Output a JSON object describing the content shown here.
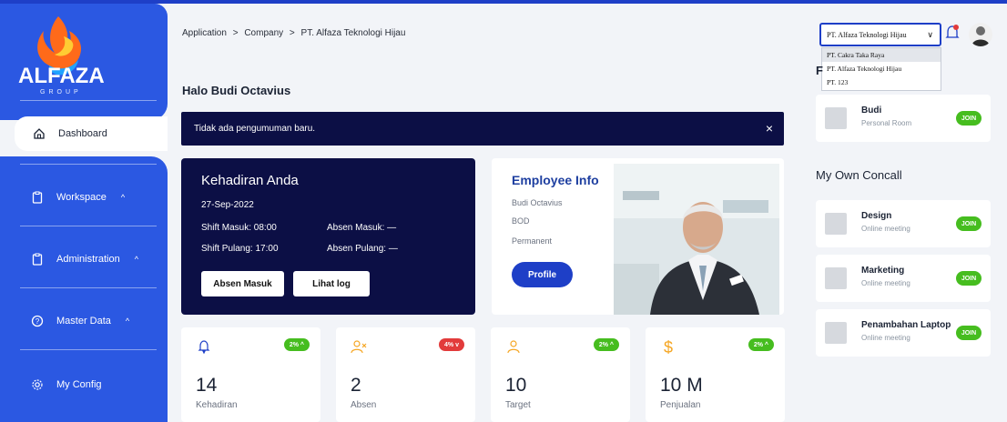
{
  "brand": {
    "name": "ALFAZA",
    "sub": "GROUP"
  },
  "sidebar": {
    "items": [
      {
        "label": "Dashboard"
      },
      {
        "label": "Workspace"
      },
      {
        "label": "Administration"
      },
      {
        "label": "Master Data"
      },
      {
        "label": "My Config"
      }
    ]
  },
  "breadcrumb": {
    "a": "Application",
    "sep": ">",
    "b": "Company",
    "c": "PT. Alfaza Teknologi Hijau"
  },
  "greeting": "Halo Budi Octavius",
  "announcement": {
    "text": "Tidak ada pengumuman baru.",
    "close": "×"
  },
  "attendance": {
    "title": "Kehadiran Anda",
    "date": "27-Sep-2022",
    "shift_in": "Shift Masuk: 08:00",
    "absen_in": "Absen Masuk: —",
    "shift_out": "Shift Pulang: 17:00",
    "absen_out": "Absen Pulang: —",
    "btn_absen": "Absen Masuk",
    "btn_log": "Lihat log"
  },
  "employee": {
    "title": "Employee Info",
    "name": "Budi Octavius",
    "position": "BOD",
    "status": "Permanent",
    "btn_profile": "Profile"
  },
  "stats": [
    {
      "icon": "bell-icon",
      "pill": "2% ^",
      "pill_color": "#46bd1f",
      "value": "14",
      "label": "Kehadiran",
      "icon_color": "#1e3fc7"
    },
    {
      "icon": "user-x-icon",
      "pill": "4% v",
      "pill_color": "#e23b3b",
      "value": "2",
      "label": "Absen",
      "icon_color": "#f5a623"
    },
    {
      "icon": "user-icon",
      "pill": "2% ^",
      "pill_color": "#46bd1f",
      "value": "10",
      "label": "Target",
      "icon_color": "#f5a623"
    },
    {
      "icon": "dollar-icon",
      "pill": "2% ^",
      "pill_color": "#46bd1f",
      "value": "10 M",
      "label": "Penjualan",
      "icon_color": "#f5a623"
    }
  ],
  "company_select": {
    "selected": "PT. Alfaza Teknologi Hijau",
    "options": [
      "PT. Cakra Taka Raya",
      "PT. Alfaza Teknologi Hijau",
      "PT. 123"
    ]
  },
  "right": {
    "partial_head": "F",
    "personal": {
      "name": "Budi",
      "sub": "Personal Room",
      "join": "JOIN"
    },
    "section": "My Own Concall",
    "calls": [
      {
        "name": "Design",
        "sub": "Online meeting",
        "join": "JOIN"
      },
      {
        "name": "Marketing",
        "sub": "Online meeting",
        "join": "JOIN"
      },
      {
        "name": "Penambahan Laptop",
        "sub": "Online meeting",
        "join": "JOIN"
      }
    ]
  }
}
